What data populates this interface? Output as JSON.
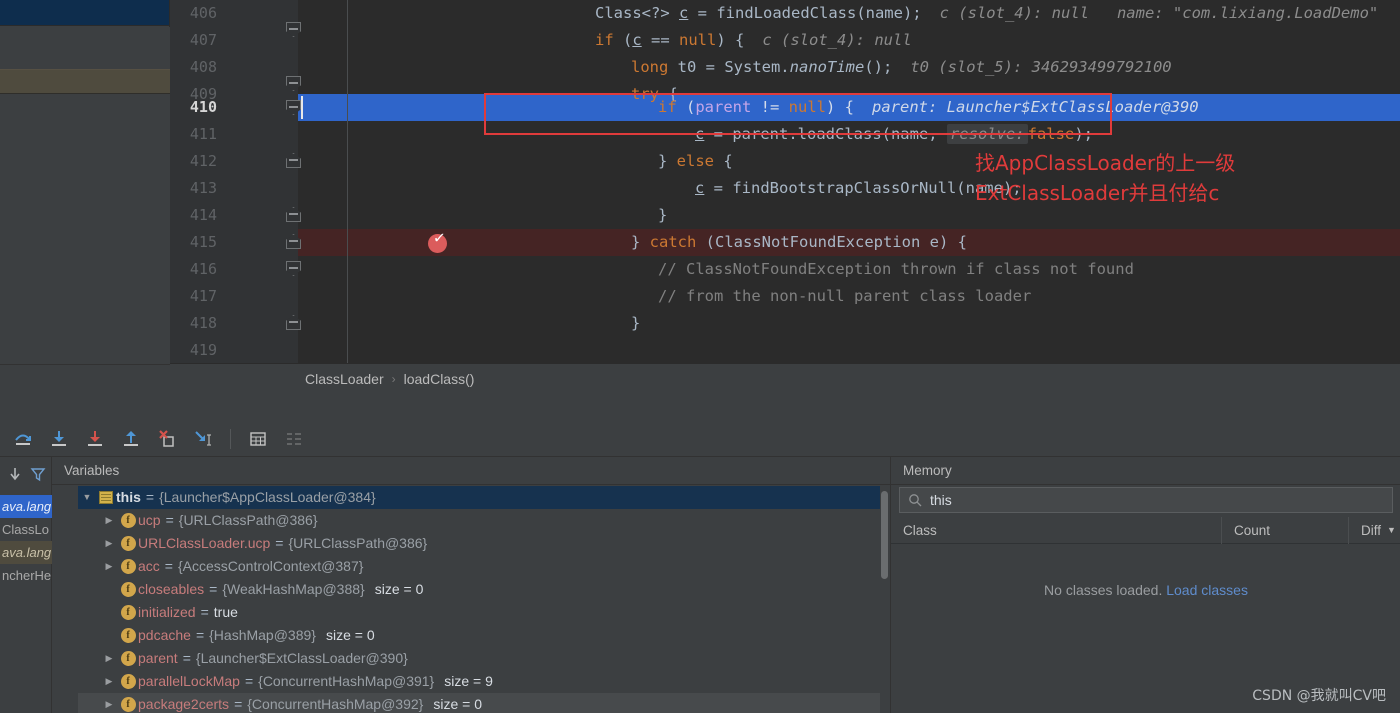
{
  "editor": {
    "line_numbers": [
      "406",
      "407",
      "408",
      "409",
      "410",
      "411",
      "412",
      "413",
      "414",
      "415",
      "416",
      "417",
      "418",
      "419"
    ],
    "current_line": "410",
    "lines": [
      {
        "n": "406",
        "code": "Class<?> c = findLoadedClass(name);",
        "hint": "c (slot_4): null   name: \"com.lixiang.LoadDemo\""
      },
      {
        "n": "407",
        "code": "if (c == null) {",
        "hint": "c (slot_4): null"
      },
      {
        "n": "408",
        "code": "long t0 = System.nanoTime();",
        "hint": "t0 (slot_5): 346293499792100"
      },
      {
        "n": "409",
        "code": "try {",
        "hint": ""
      },
      {
        "n": "410",
        "code": "if (parent != null) {",
        "hint": "parent: Launcher$ExtClassLoader@390"
      },
      {
        "n": "411",
        "code": "c = parent.loadClass(name, resolve: false);",
        "hint": "resolve:"
      },
      {
        "n": "412",
        "code": "} else {",
        "hint": ""
      },
      {
        "n": "413",
        "code": "c = findBootstrapClassOrNull(name);",
        "hint": ""
      },
      {
        "n": "414",
        "code": "}",
        "hint": ""
      },
      {
        "n": "415",
        "code": "} catch (ClassNotFoundException e) {",
        "hint": ""
      },
      {
        "n": "416",
        "code": "// ClassNotFoundException thrown if class not found",
        "hint": ""
      },
      {
        "n": "417",
        "code": "// from the non-null parent class loader",
        "hint": ""
      },
      {
        "n": "418",
        "code": "}",
        "hint": ""
      },
      {
        "n": "419",
        "code": "",
        "hint": ""
      }
    ],
    "tokens": {
      "t406_a": "Class<?> ",
      "t406_c": "c",
      "t406_b": " = findLoadedClass(name);",
      "t406_hint": "c (slot_4): null   name: \"com.lixiang.LoadDemo\"",
      "t407_if": "if",
      "t407_p1": " (",
      "t407_c": "c",
      "t407_eq": " == ",
      "t407_null": "null",
      "t407_p2": ") {",
      "t407_hint": "c (slot_4): null",
      "t408_long": "long",
      "t408_rest": " t0 = System.",
      "t408_m": "nanoTime",
      "t408_tail": "();",
      "t408_hint": "t0 (slot_5): 346293499792100",
      "t409_try": "try",
      "t409_br": " {",
      "t410_if": "if",
      "t410_p1": " (",
      "t410_parent": "parent",
      "t410_ne": " != ",
      "t410_null": "null",
      "t410_p2": ") {",
      "t410_hint": "parent: Launcher$ExtClassLoader@390",
      "t411_c": "c",
      "t411_mid": " = parent.loadClass(name, ",
      "t411_hint": "resolve:",
      "t411_false": "false",
      "t411_end": ");",
      "t412_a": "} ",
      "t412_else": "else",
      "t412_b": " {",
      "t413_c": "c",
      "t413_rest": " = findBootstrapClassOrNull(name);",
      "t414": "}",
      "t415_a": "} ",
      "t415_catch": "catch",
      "t415_b": " (ClassNotFoundException e) {",
      "t416": "// ClassNotFoundException thrown if class not found",
      "t417": "// from the non-null parent class loader",
      "t418": "}"
    },
    "annotation": "找AppClassLoader的上一级\nExtClassLoader并且付给c",
    "annotation_color": "#e03b3b",
    "highlight_box_color": "#e03b3b",
    "selection_color": "#2f65ca"
  },
  "breadcrumb": {
    "items": [
      "ClassLoader",
      "loadClass()"
    ],
    "separator": "›"
  },
  "toolbar": {
    "buttons": [
      {
        "name": "step-over-icon",
        "label": "Step Over"
      },
      {
        "name": "step-into-icon",
        "label": "Step Into"
      },
      {
        "name": "force-step-into-icon",
        "label": "Force Step Into"
      },
      {
        "name": "step-out-icon",
        "label": "Step Out"
      },
      {
        "name": "drop-frame-icon",
        "label": "Drop Frame"
      },
      {
        "name": "run-to-cursor-icon",
        "label": "Run to Cursor"
      },
      {
        "name": "evaluate-expression-icon",
        "label": "Evaluate Expression"
      },
      {
        "name": "show-execution-point-icon",
        "label": "Show Execution Point"
      }
    ]
  },
  "frames": {
    "rows": [
      {
        "text": "ava.lang",
        "style": "selected"
      },
      {
        "text": "ClassLo",
        "style": "plain"
      },
      {
        "text": "ava.lang",
        "style": "olive"
      },
      {
        "text": "ncherHe",
        "style": "plain"
      }
    ],
    "rail_icons": [
      "sort-down-icon",
      "filter-icon"
    ],
    "side_buttons": [
      "plus-icon",
      "minus-icon",
      "up-icon",
      "down-icon",
      "copy-icon",
      "watches-icon"
    ]
  },
  "variables": {
    "title": "Variables",
    "rows": [
      {
        "arrow": "▼",
        "icon": "this-icon",
        "name": "this",
        "eq": "=",
        "value": "{Launcher$AppClassLoader@384}",
        "size": "",
        "selected": true
      },
      {
        "arrow": "▶",
        "icon": "field-icon",
        "name": "ucp",
        "eq": "=",
        "value": "{URLClassPath@386}",
        "size": "",
        "selected": false
      },
      {
        "arrow": "▶",
        "icon": "field-icon",
        "name": "URLClassLoader.ucp",
        "eq": "=",
        "value": "{URLClassPath@386}",
        "size": "",
        "selected": false
      },
      {
        "arrow": "▶",
        "icon": "field-icon",
        "name": "acc",
        "eq": "=",
        "value": "{AccessControlContext@387}",
        "size": "",
        "selected": false
      },
      {
        "arrow": "",
        "icon": "field-icon",
        "name": "closeables",
        "eq": "=",
        "value": "{WeakHashMap@388}",
        "size": "size = 0",
        "selected": false
      },
      {
        "arrow": "",
        "icon": "field-icon",
        "name": "initialized",
        "eq": "=",
        "value": "true",
        "size": "",
        "selected": false
      },
      {
        "arrow": "",
        "icon": "field-icon",
        "name": "pdcache",
        "eq": "=",
        "value": "{HashMap@389}",
        "size": "size = 0",
        "selected": false
      },
      {
        "arrow": "▶",
        "icon": "field-icon",
        "name": "parent",
        "eq": "=",
        "value": "{Launcher$ExtClassLoader@390}",
        "size": "",
        "selected": false
      },
      {
        "arrow": "▶",
        "icon": "field-icon",
        "name": "parallelLockMap",
        "eq": "=",
        "value": "{ConcurrentHashMap@391}",
        "size": "size = 9",
        "selected": false
      },
      {
        "arrow": "▶",
        "icon": "field-icon",
        "name": "package2certs",
        "eq": "=",
        "value": "{ConcurrentHashMap@392}",
        "size": "size = 0",
        "selected": false
      }
    ]
  },
  "memory": {
    "title": "Memory",
    "search_value": "this",
    "search_icon": "search-icon",
    "columns": [
      "Class",
      "Count",
      "Diff"
    ],
    "diff_sort_icon": "▼",
    "empty_text": "No classes loaded.",
    "empty_link": "Load classes"
  },
  "watermark": {
    "text": "CSDN @我就叫CV吧"
  }
}
